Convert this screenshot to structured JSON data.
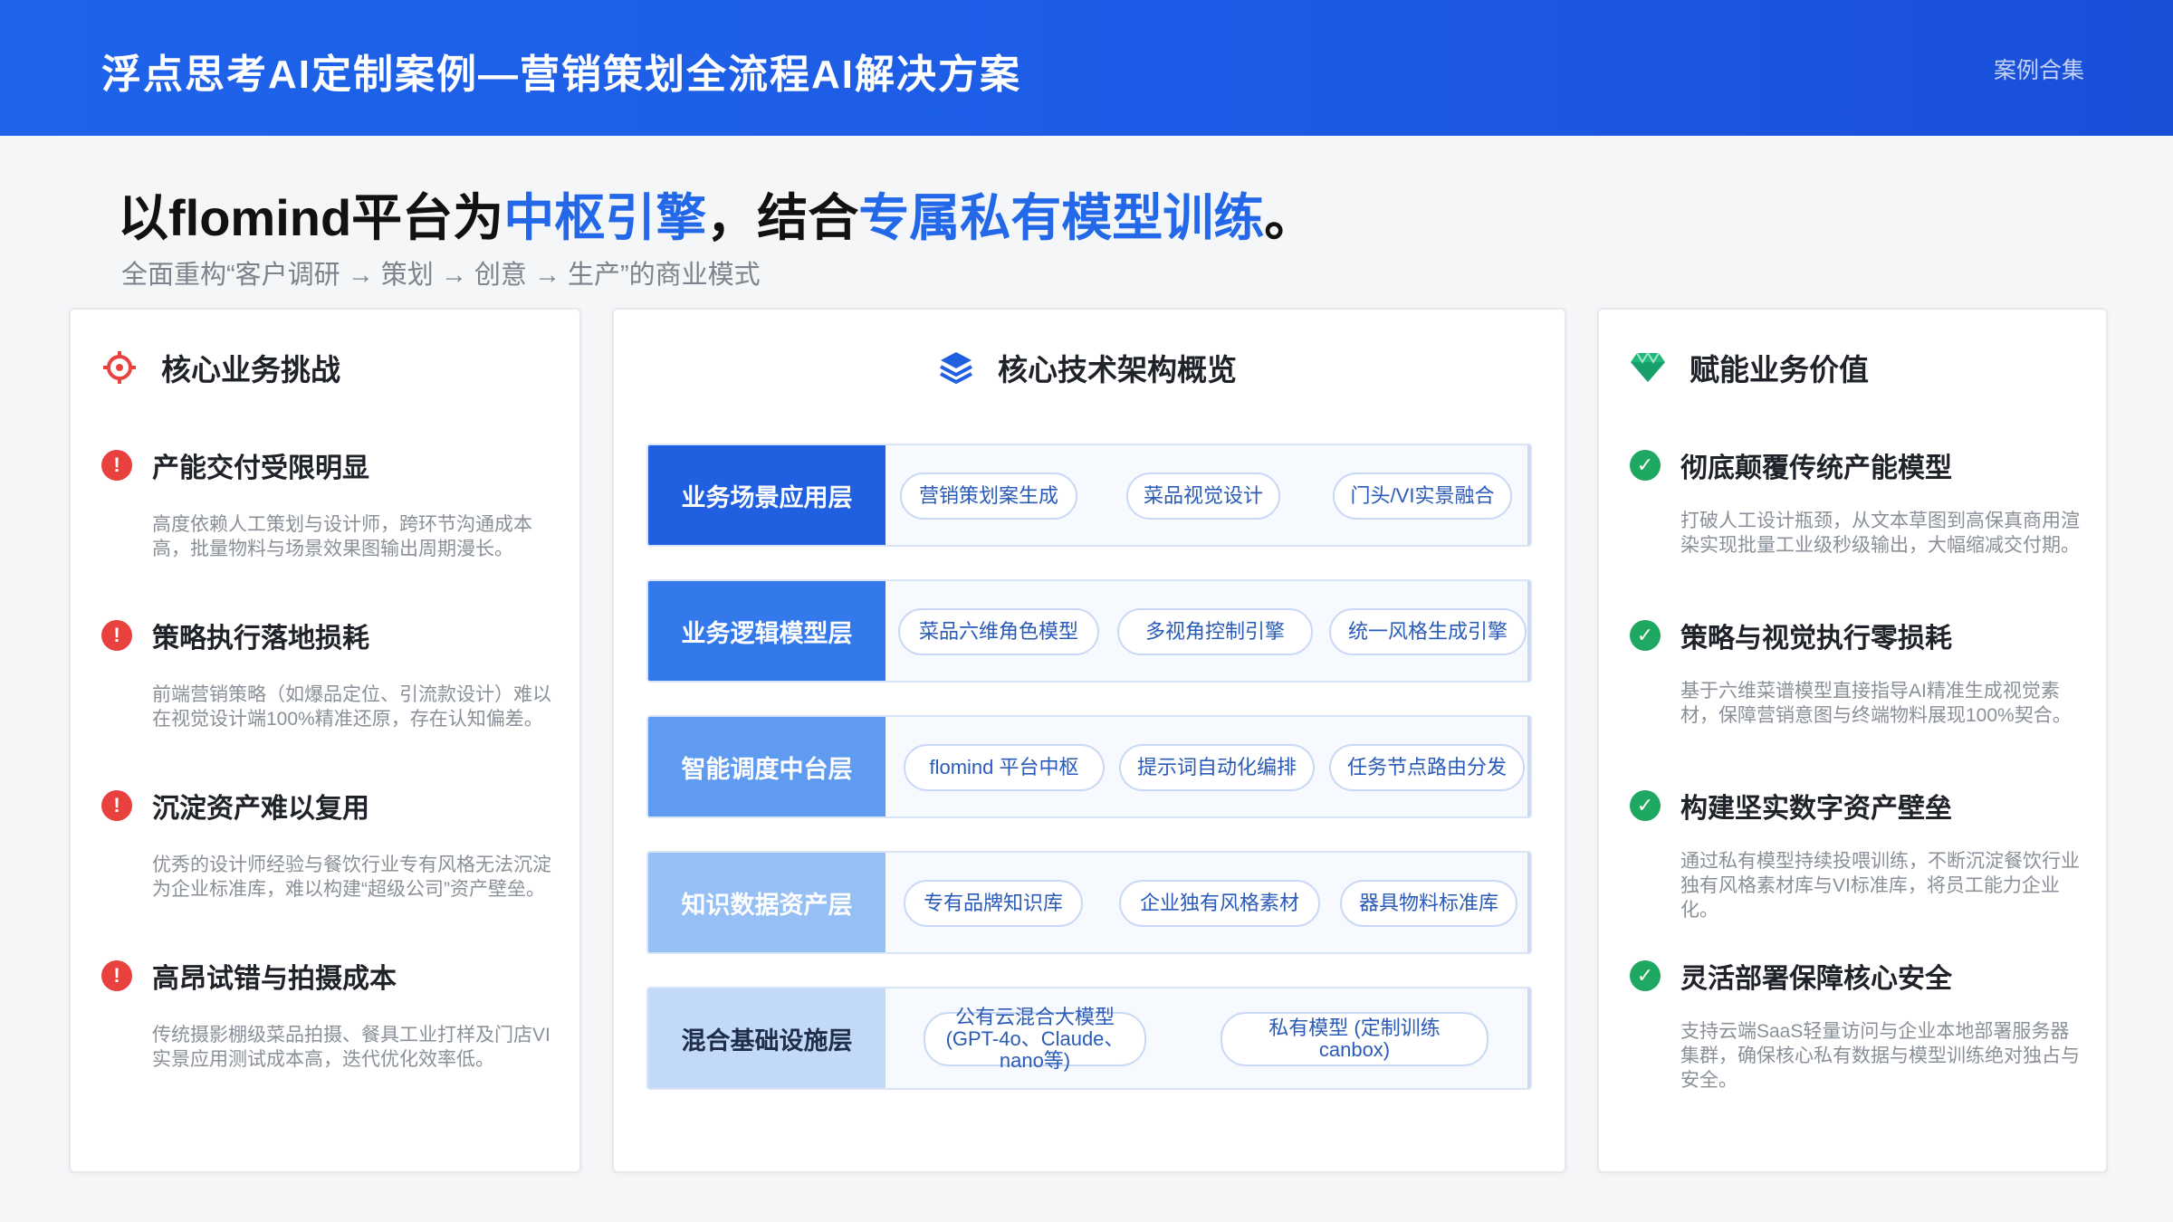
{
  "header": {
    "title": "浮点思考AI定制案例—营销策划全流程AI解决方案",
    "tag": "案例合集"
  },
  "headline": {
    "part1": "以flomind平台为",
    "part2": "中枢引擎",
    "part3": "，结合",
    "part4": "专属私有模型训练",
    "part5": "。",
    "subline": "全面重构“客户调研 → 策划 → 创意 → 生产”的商业模式"
  },
  "left": {
    "title": "核心业务挑战",
    "items": [
      {
        "title": "产能交付受限明显",
        "desc": "高度依赖人工策划与设计师，跨环节沟通成本高，批量物料与场景效果图输出周期漫长。"
      },
      {
        "title": "策略执行落地损耗",
        "desc": "前端营销策略（如爆品定位、引流款设计）难以在视觉设计端100%精准还原，存在认知偏差。"
      },
      {
        "title": "沉淀资产难以复用",
        "desc": "优秀的设计师经验与餐饮行业专有风格无法沉淀为企业标准库，难以构建“超级公司”资产壁垒。"
      },
      {
        "title": "高昂试错与拍摄成本",
        "desc": "传统摄影棚级菜品拍摄、餐具工业打样及门店VI实景应用测试成本高，迭代优化效率低。"
      }
    ]
  },
  "middle": {
    "title": "核心技术架构概览",
    "layers": [
      {
        "label": "业务场景应用层",
        "color": "#1f5fe0",
        "pills": [
          "营销策划案生成",
          "菜品视觉设计",
          "门头/VI实景融合"
        ]
      },
      {
        "label": "业务逻辑模型层",
        "color": "#3479ec",
        "pills": [
          "菜品六维角色模型",
          "多视角控制引擎",
          "统一风格生成引擎"
        ]
      },
      {
        "label": "智能调度中台层",
        "color": "#5f9bf0",
        "pills": [
          "flomind 平台中枢",
          "提示词自动化编排",
          "任务节点路由分发"
        ]
      },
      {
        "label": "知识数据资产层",
        "color": "#95bff5",
        "pills": [
          "专有品牌知识库",
          "企业独有风格素材",
          "器具物料标准库"
        ]
      },
      {
        "label": "混合基础设施层",
        "color": "#c2daf8",
        "labelColor": "#1f2d4a",
        "pills": [
          "公有云混合大模型 (GPT-4o、Claude、nano等)",
          "私有模型 (定制训练 canbox)"
        ]
      }
    ]
  },
  "right": {
    "title": "赋能业务价值",
    "items": [
      {
        "title": "彻底颠覆传统产能模型",
        "desc": "打破人工设计瓶颈，从文本草图到高保真商用渲染实现批量工业级秒级输出，大幅缩减交付期。"
      },
      {
        "title": "策略与视觉执行零损耗",
        "desc": "基于六维菜谱模型直接指导AI精准生成视觉素材，保障营销意图与终端物料展现100%契合。"
      },
      {
        "title": "构建坚实数字资产壁垒",
        "desc": "通过私有模型持续投喂训练，不断沉淀餐饮行业独有风格素材库与VI标准库，将员工能力企业化。"
      },
      {
        "title": "灵活部署保障核心安全",
        "desc": "支持云端SaaS轻量访问与企业本地部署服务器集群，确保核心私有数据与模型训练绝对独占与安全。"
      }
    ]
  },
  "colors": {
    "accent": "#2268e8",
    "alert": "#e8413e",
    "ok": "#1fa862",
    "gem": "#20b87a"
  }
}
